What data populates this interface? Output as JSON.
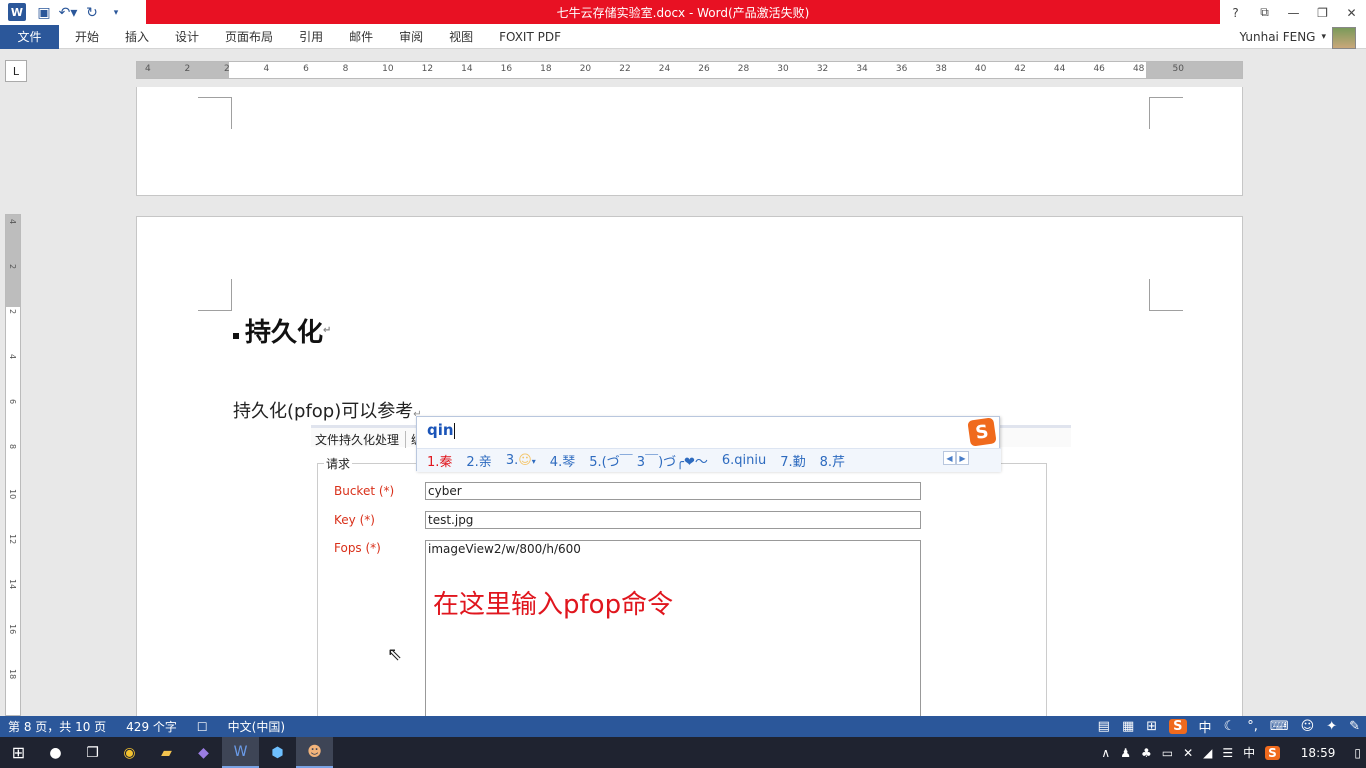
{
  "titlebar": {
    "title": "七牛云存储实验室.docx -  Word(产品激活失败)",
    "controls": [
      "?",
      "⧉",
      "—",
      "❐",
      "✕"
    ]
  },
  "qat": {
    "icons": [
      "word-logo-icon",
      "save-icon",
      "undo-icon",
      "redo-icon",
      "customize-icon"
    ]
  },
  "ribbon": {
    "tabs": [
      "文件",
      "开始",
      "插入",
      "设计",
      "页面布局",
      "引用",
      "邮件",
      "审阅",
      "视图",
      "FOXIT PDF"
    ],
    "user": "Yunhai FENG"
  },
  "ruler": {
    "labels": [
      "4",
      "2",
      "2",
      "4",
      "6",
      "8",
      "10",
      "12",
      "14",
      "16",
      "18",
      "20",
      "22",
      "24",
      "26",
      "28",
      "30",
      "32",
      "34",
      "36",
      "38",
      "40",
      "42",
      "44",
      "46",
      "48",
      "50"
    ],
    "vlabels": [
      "4",
      "2",
      "2",
      "4",
      "6",
      "8",
      "10",
      "12",
      "14",
      "16",
      "18"
    ]
  },
  "document": {
    "heading": "持久化",
    "body": "持久化(pfop)可以参考",
    "paragraph_mark": "↵"
  },
  "embedded_form": {
    "tab_label": "文件持久化处理",
    "tab_extra": "编",
    "legend": "请求",
    "fields": [
      {
        "label": "Bucket (*)",
        "value": "cyber"
      },
      {
        "label": "Key (*)",
        "value": "test.jpg"
      },
      {
        "label": "Fops (*)",
        "value": "imageView2/w/800/h/600"
      }
    ],
    "note": "在这里输入pfop命令"
  },
  "ime": {
    "input": "qin",
    "candidates": [
      "1.秦",
      "2.亲",
      "3.",
      "4.琴",
      "5.(づ￣ 3￣)づ╭❤～",
      "6.qiniu",
      "7.勤",
      "8.芹"
    ],
    "logo": "S"
  },
  "statusbar": {
    "page": "第 8 页，共 10 页",
    "words": "429 个字",
    "language": "中文(中国)"
  },
  "taskbar": {
    "time": "18:59",
    "ime_lang": "中"
  }
}
